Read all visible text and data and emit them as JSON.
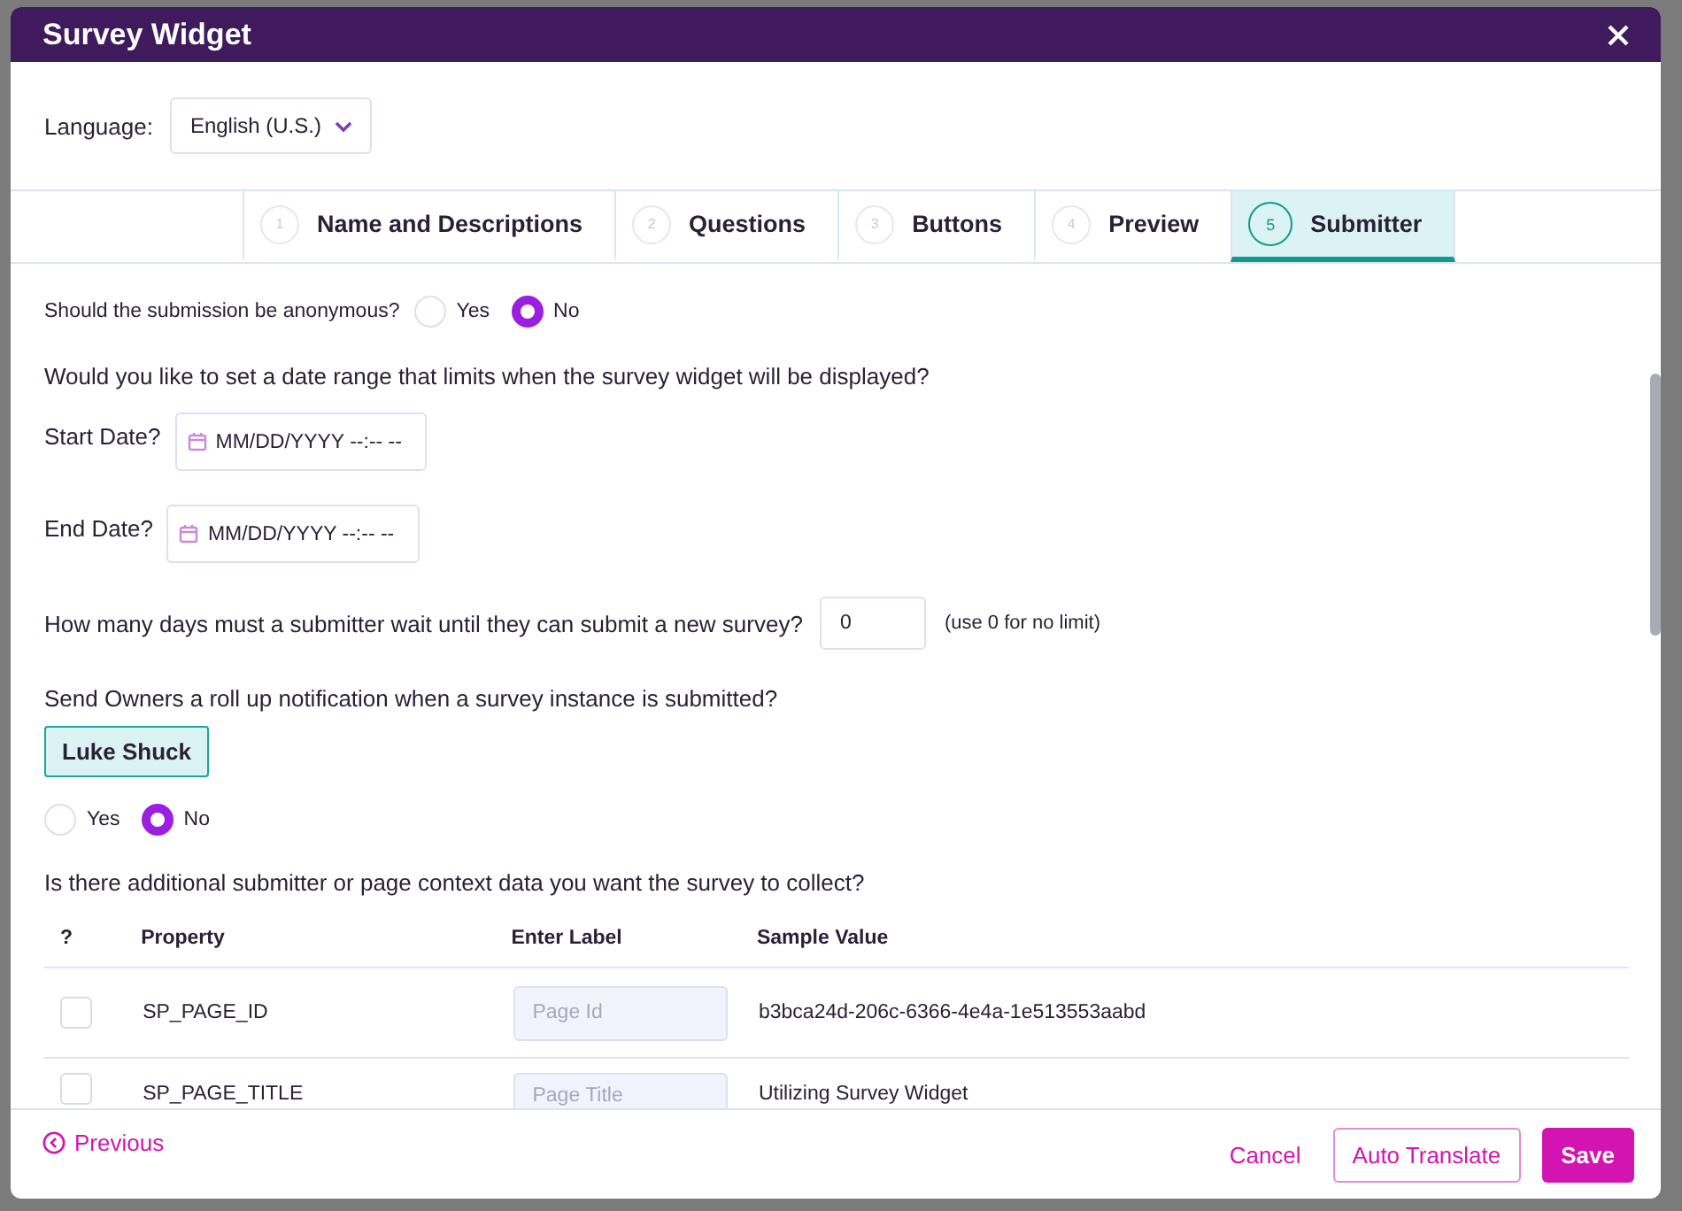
{
  "window": {
    "title": "Survey Widget"
  },
  "language": {
    "label": "Language:",
    "value": "English (U.S.)"
  },
  "steps": [
    {
      "number": "1",
      "label": "Name and Descriptions",
      "selected": false
    },
    {
      "number": "2",
      "label": "Questions",
      "selected": false
    },
    {
      "number": "3",
      "label": "Buttons",
      "selected": false
    },
    {
      "number": "4",
      "label": "Preview",
      "selected": false
    },
    {
      "number": "5",
      "label": "Submitter",
      "selected": true
    }
  ],
  "anonymous": {
    "question": "Should the submission be anonymous?",
    "options": [
      {
        "label": "Yes",
        "selected": false
      },
      {
        "label": "No",
        "selected": true
      }
    ]
  },
  "date_range": {
    "question": "Would you like to set a date range that limits when the survey widget will be displayed?",
    "fields": [
      {
        "label": "Start Date?",
        "placeholder": "MM/DD/YYYY --:-- --"
      },
      {
        "label": "End Date?",
        "placeholder": "MM/DD/YYYY --:-- --"
      }
    ]
  },
  "wait": {
    "question": "How many days must a submitter wait until they can submit a new survey?",
    "value": "0",
    "hint": "(use 0 for no limit)"
  },
  "rollup": {
    "question": "Send Owners a roll up notification when a survey instance is submitted?",
    "owners": [
      "Luke Shuck"
    ],
    "options": [
      {
        "label": "Yes",
        "selected": false
      },
      {
        "label": "No",
        "selected": true
      }
    ]
  },
  "context": {
    "question": "Is there additional submitter or page context data you want the survey to collect?",
    "columns": [
      "?",
      "Property",
      "Enter Label",
      "Sample Value"
    ],
    "rows": [
      {
        "checked": false,
        "property": "SP_PAGE_ID",
        "label_placeholder": "Page Id",
        "sample": "b3bca24d-206c-6366-4e4a-1e513553aabd"
      },
      {
        "checked": false,
        "property": "SP_PAGE_TITLE",
        "label_placeholder": "Page Title",
        "sample": "Utilizing Survey Widget"
      }
    ]
  },
  "footer": {
    "previous": "Previous",
    "cancel": "Cancel",
    "auto_translate": "Auto Translate",
    "save": "Save"
  }
}
